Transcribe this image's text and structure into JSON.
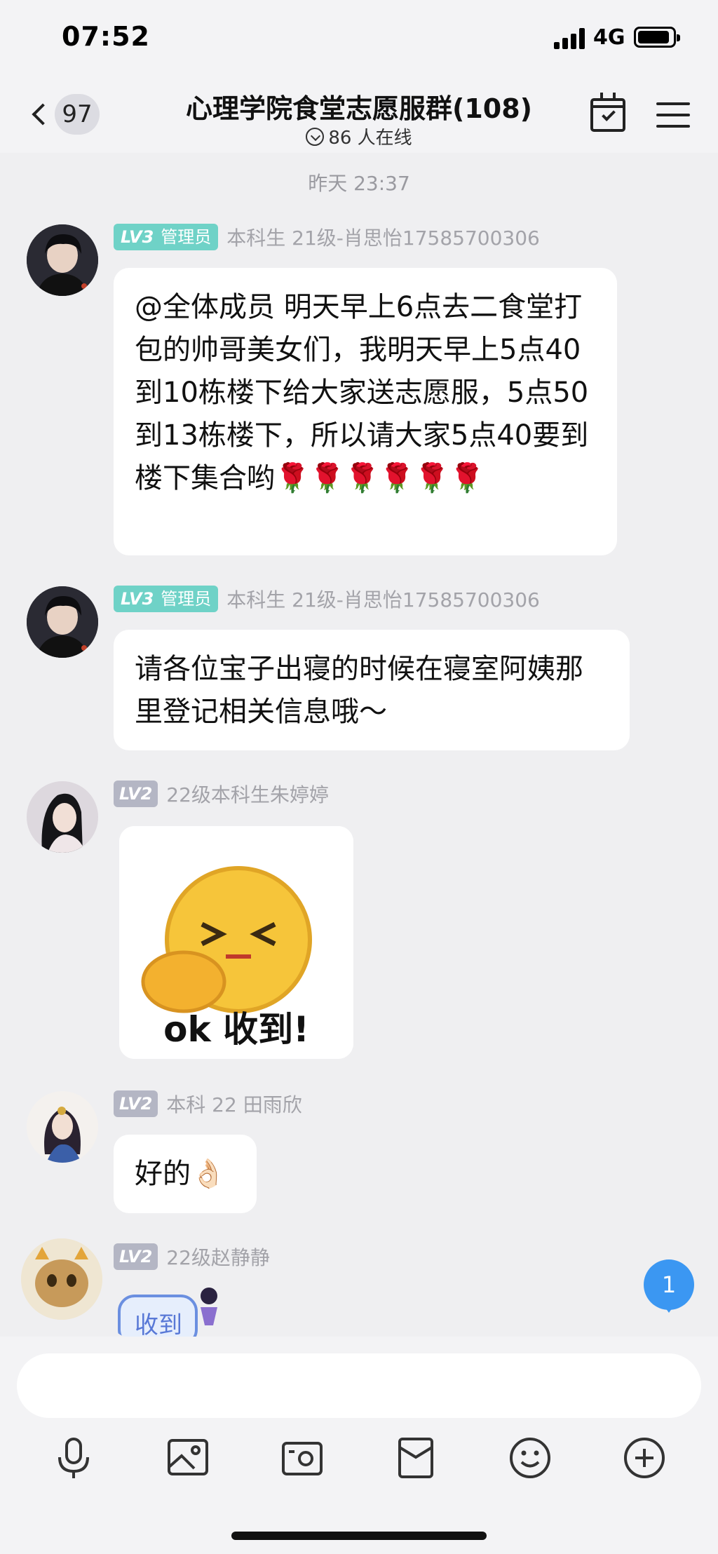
{
  "status_bar": {
    "time": "07:52",
    "network": "4G"
  },
  "header": {
    "unread_count": "97",
    "title": "心理学院食堂志愿服群(108)",
    "online": "86 人在线"
  },
  "messages": {
    "timestamp": "昨天 23:37",
    "m1": {
      "level": "LV3",
      "role": "管理员",
      "sender": "本科生 21级-肖思怡17585700306",
      "text": "@全体成员 明天早上6点去二食堂打包的帅哥美女们，我明天早上5点40到10栋楼下给大家送志愿服，5点50到13栋楼下，所以请大家5点40要到楼下集合哟🌹🌹🌹🌹🌹🌹"
    },
    "m2": {
      "level": "LV3",
      "role": "管理员",
      "sender": "本科生 21级-肖思怡17585700306",
      "text": "请各位宝子出寝的时候在寝室阿姨那里登记相关信息哦～"
    },
    "m3": {
      "level": "LV2",
      "sender": "22级本科生朱婷婷",
      "sticker_text": "ok 收到!"
    },
    "m4": {
      "level": "LV2",
      "sender": "本科 22 田雨欣",
      "text": "好的👌🏻"
    },
    "m5": {
      "level": "LV2",
      "sender": "22级赵静静",
      "sticker_text": "收到"
    }
  },
  "new_message_count": "1",
  "input": {
    "placeholder": ""
  },
  "toolbar": {
    "icons": [
      "microphone-icon",
      "image-icon",
      "camera-icon",
      "red-packet-icon",
      "emoji-icon",
      "plus-icon"
    ]
  },
  "colors": {
    "background": "#efeff1",
    "bubble": "#ffffff",
    "admin_badge": "#6fd2c7",
    "level_badge": "#b4b6c4",
    "accent_blue": "#3b97f2"
  }
}
